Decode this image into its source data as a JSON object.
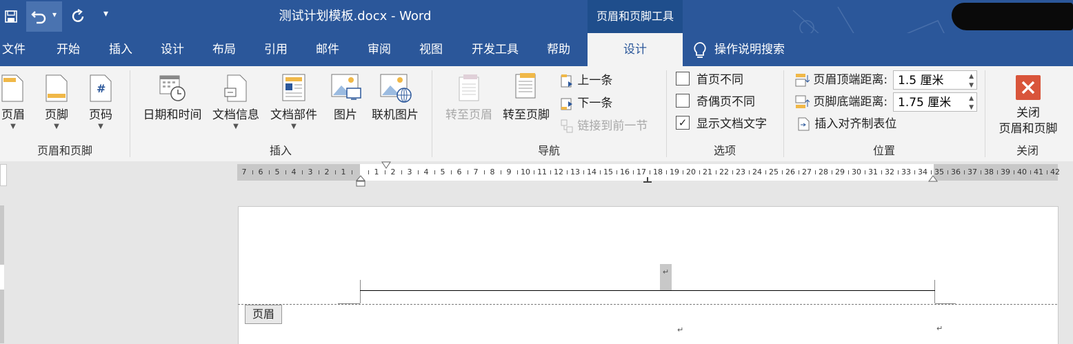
{
  "window": {
    "title": "测试计划模板.docx  -  Word",
    "context_tool": "页眉和页脚工具"
  },
  "quick_access": {
    "save_icon": "save-icon",
    "undo_icon": "undo-icon",
    "undo_dropdown": "▾",
    "redo_icon": "redo-icon",
    "customize": "▾"
  },
  "tabs": [
    "文件",
    "开始",
    "插入",
    "设计",
    "布局",
    "引用",
    "邮件",
    "审阅",
    "视图",
    "开发工具",
    "帮助"
  ],
  "active_tab": "设计",
  "tell_me": "操作说明搜索",
  "ribbon": {
    "header_footer_group": {
      "label": "页眉和页脚",
      "buttons": [
        "页眉",
        "页脚",
        "页码"
      ]
    },
    "insert_group": {
      "label": "插入",
      "buttons": [
        "日期和时间",
        "文档信息",
        "文档部件",
        "图片",
        "联机图片"
      ]
    },
    "nav_group": {
      "label": "导航",
      "goto_header": "转至页眉",
      "goto_footer": "转至页脚",
      "previous": "上一条",
      "next": "下一条",
      "link_previous": "链接到前一节"
    },
    "options_group": {
      "label": "选项",
      "different_first": "首页不同",
      "different_odd_even": "奇偶页不同",
      "show_doc_text": "显示文档文字",
      "show_doc_text_checked": "✓"
    },
    "position_group": {
      "label": "位置",
      "header_from_top_label": "页眉顶端距离:",
      "header_from_top_value": "1.5 厘米",
      "footer_from_bottom_label": "页脚底端距离:",
      "footer_from_bottom_value": "1.75 厘米",
      "insert_align_tab": "插入对齐制表位"
    },
    "close_group": {
      "label": "关闭",
      "close_line1": "关闭",
      "close_line2": "页眉和页脚"
    }
  },
  "ruler": {
    "left_numbers": [
      "7",
      "6",
      "5",
      "4",
      "3",
      "2",
      "1"
    ],
    "right_numbers": [
      "1",
      "2",
      "3",
      "4",
      "5",
      "6",
      "7",
      "8",
      "9",
      "10",
      "11",
      "12",
      "13",
      "14",
      "15",
      "16",
      "17",
      "18",
      "19",
      "20",
      "21",
      "22",
      "23",
      "24",
      "25",
      "26",
      "27",
      "28",
      "29",
      "30",
      "31",
      "32",
      "33",
      "34",
      "35",
      "36",
      "37",
      "38",
      "39",
      "40",
      "41",
      "42"
    ]
  },
  "document": {
    "header_tag": "页眉",
    "paragraph_mark": "↵"
  }
}
